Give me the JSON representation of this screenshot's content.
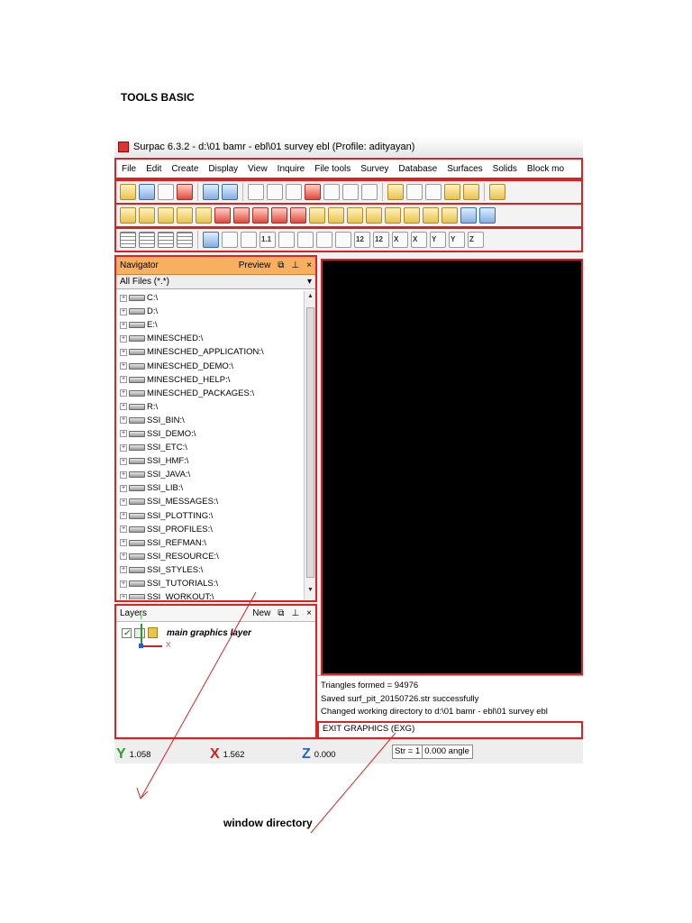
{
  "doc": {
    "heading": "TOOLS BASIC",
    "caption": "window directory"
  },
  "window": {
    "title": "Surpac 6.3.2 - d:\\01 bamr - ebl\\01 survey ebl (Profile: adityayan)"
  },
  "menu": [
    "File",
    "Edit",
    "Create",
    "Display",
    "View",
    "Inquire",
    "File tools",
    "Survey",
    "Database",
    "Surfaces",
    "Solids",
    "Block mo"
  ],
  "navigator": {
    "title": "Navigator",
    "preview_label": "Preview",
    "float_icon": "float-icon",
    "pin_icon": "pin-icon",
    "close_glyph": "×",
    "filter": "All Files (*.*)",
    "items": [
      "C:\\",
      "D:\\",
      "E:\\",
      "MINESCHED:\\",
      "MINESCHED_APPLICATION:\\",
      "MINESCHED_DEMO:\\",
      "MINESCHED_HELP:\\",
      "MINESCHED_PACKAGES:\\",
      "R:\\",
      "SSI_BIN:\\",
      "SSI_DEMO:\\",
      "SSI_ETC:\\",
      "SSI_HMF:\\",
      "SSI_JAVA:\\",
      "SSI_LIB:\\",
      "SSI_MESSAGES:\\",
      "SSI_PLOTTING:\\",
      "SSI_PROFILES:\\",
      "SSI_REFMAN:\\",
      "SSI_RESOURCE:\\",
      "SSI_STYLES:\\",
      "SSI_TUTORIALS:\\",
      "SSI_WORKOUT:\\"
    ]
  },
  "layers": {
    "title": "Layers",
    "new_label": "New",
    "close_glyph": "×",
    "layer_name": "main graphics layer"
  },
  "graphics": {
    "axis_y_label": "Y",
    "axis_x_label": "X"
  },
  "messages": {
    "lines": [
      "Triangles formed = 94976",
      "Saved surf_pit_20150726.str successfully",
      "Changed working directory to d:\\01 bamr - ebl\\01 survey ebl"
    ],
    "command": "EXIT GRAPHICS (EXG)"
  },
  "status": {
    "y_value": "1.058",
    "x_value": "1.562",
    "z_value": "0.000",
    "str_label": "Str = 1",
    "angle_label": "0.000 angle"
  },
  "toolbar": {
    "row3_labels": [
      "1.1",
      "12",
      "12",
      "X",
      "X",
      "Y",
      "Y",
      "Z"
    ]
  },
  "colors": {
    "annotation_red": "#e02020",
    "panel_orange": "#f7b060",
    "graphics_bg": "#000000"
  }
}
